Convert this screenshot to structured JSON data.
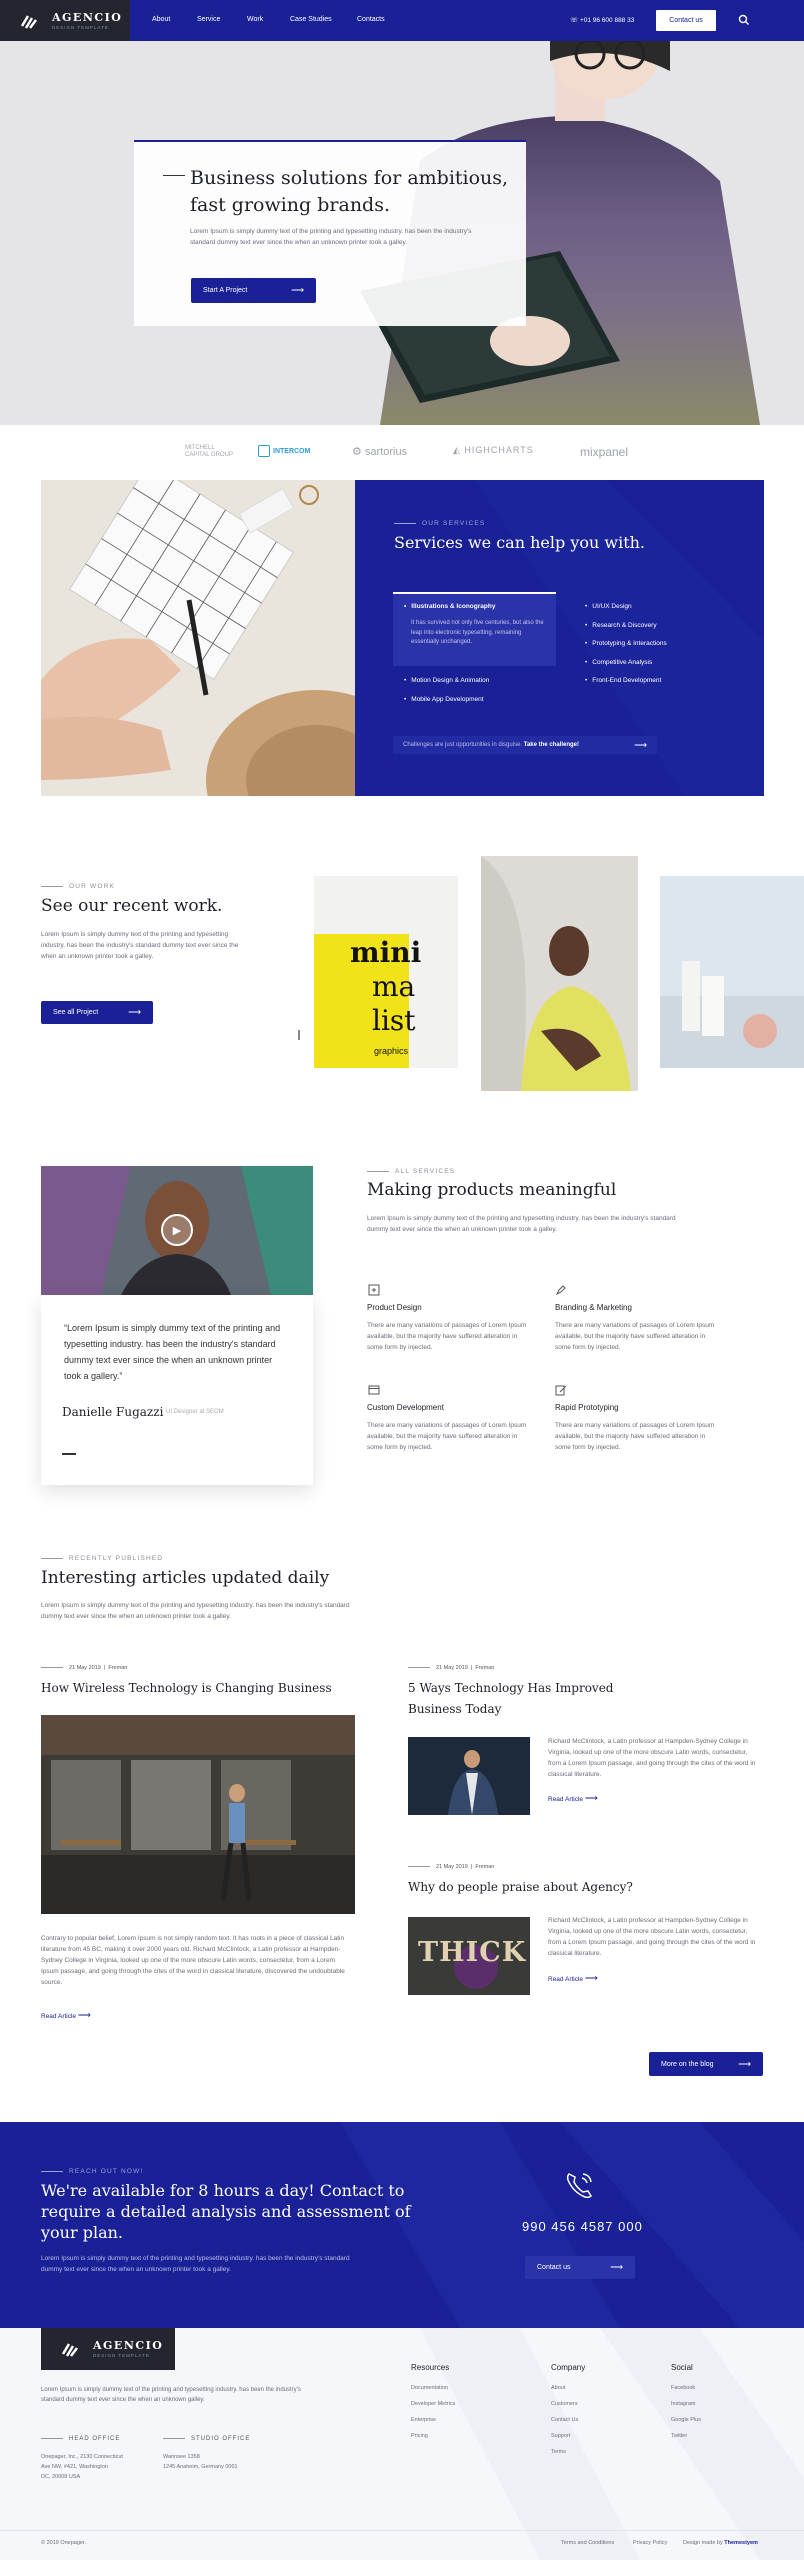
{
  "nav": {
    "brand": "AGENCIO",
    "brand_sub": "DESIGN TEMPLATE",
    "items": [
      "About",
      "Service",
      "Work",
      "Case Studies",
      "Contacts"
    ],
    "phone": "+01 96 600 888 33",
    "contact_label": "Contact us",
    "search_icon": "search-icon"
  },
  "hero": {
    "title": "Business solutions for ambitious, fast growing brands.",
    "text": "Lorem Ipsum is simply dummy text of the printing and typesetting industry. has been the industry's standard dummy text ever since the when an unknown printer took a galley.",
    "button": "Start A Project"
  },
  "logos": [
    "MITCHELL CAPITAL GROUP",
    "INTERCOM",
    "sartorius",
    "HIGHCHARTS",
    "mixpanel"
  ],
  "services": {
    "eyebrow": "OUR SERVICES",
    "title": "Services we can help you with.",
    "active_item": "Illustrations & Iconography",
    "active_desc": "It has survived not only five centuries, but also the leap into electronic typesetting, remaining essentially unchanged.",
    "left_items": [
      "Motion Design & Animation",
      "Mobile App Development"
    ],
    "right_items": [
      "UI/UX Design",
      "Research & Discovery",
      "Prototyping & Interactions",
      "Competitive Analysis",
      "Front-End Development"
    ],
    "bar_text": "Challenges are just opportunities in disguise.",
    "bar_link": "Take the challenge!"
  },
  "work": {
    "eyebrow": "OUR WORK",
    "title": "See our recent work.",
    "text": "Lorem Ipsum is simply dummy text of the printing and typesetting industry. has been the industry's standard dummy text ever since the when an unknown printer took a galley.",
    "button": "See all Project",
    "poster_words": [
      "mini",
      "ma",
      "list"
    ],
    "poster_sub": "graphics"
  },
  "testimonial": {
    "quote": "“Lorem Ipsum is simply dummy text of the printing and typesetting industry. has been the industry's standard dummy text ever since the when an unknown printer took a gallery.”",
    "name": "Danielle Fugazzi",
    "role": "UI Designer at SEOM"
  },
  "products": {
    "eyebrow": "ALL SERVICES",
    "title": "Making products meaningful",
    "text": "Lorem Ipsum is simply dummy text of the printing and typesetting industry. has been the industry's standard dummy text ever since the when an unknown printer took a galley.",
    "items": [
      {
        "name": "Product Design",
        "desc": "There are many variations of passages of Lorem Ipsum available, but the majority have suffered alteration in some form by injected.",
        "icon": "cube-icon"
      },
      {
        "name": "Branding & Marketing",
        "desc": "There are many variations of passages of Lorem Ipsum available, but the majority have suffered alteration in some form by injected.",
        "icon": "pen-icon"
      },
      {
        "name": "Custom Development",
        "desc": "There are many variations of passages of Lorem Ipsum available, but the majority have suffered alteration in some form by injected.",
        "icon": "browser-icon"
      },
      {
        "name": "Rapid Prototyping",
        "desc": "There are many variations of passages of Lorem Ipsum available, but the majority have suffered alteration in some form by injected.",
        "icon": "edit-icon"
      }
    ]
  },
  "articles": {
    "eyebrow": "RECENTLY PUBLISHED",
    "title": "Interesting articles updated daily",
    "text": "Lorem Ipsum is simply dummy text of the printing and typesetting industry. has been the industry's standard dummy text ever since the when an unknown printer took a galley.",
    "main": {
      "date": "21 May 2019",
      "author": "Freman",
      "title": "How Wireless Technology is Changing Business",
      "text": "Contrary to popular belief, Lorem Ipsum is not simply random text. It has roots in a piece of classical Latin literature from 45 BC, making it over 2000 years old. Richard McClintock, a Latin professor at Hampden-Sydney College in Virginia, looked up one of the more obscure Latin words, consectetur, from a Lorem Ipsum passage, and going through the cites of the word in classical literature, discovered the undoubtable source.",
      "read": "Read Article"
    },
    "side": [
      {
        "date": "21 May 2019",
        "author": "Freman",
        "title": "5 Ways Technology Has Improved Business Today",
        "text": "Richard McClintock, a Latin professor at Hampden-Sydney College in Virginia, looked up one of the more obscure Latin words, consectetur, from a Lorem Ipsum passage, and going through the cites of the word in classical literature.",
        "read": "Read Article"
      },
      {
        "date": "21 May 2019",
        "author": "Freman",
        "title": "Why do people praise about Agency?",
        "text": "Richard McClintock, a Latin professor at Hampden-Sydney College in Virginia, looked up one of the more obscure Latin words, consectetur, from a Lorem Ipsum passage, and going through the cites of the word in classical literature.",
        "read": "Read Article",
        "image_word": "THICK"
      }
    ],
    "more_button": "More on the blog"
  },
  "cta": {
    "eyebrow": "REACH OUT NOW!",
    "title": "We're available for 8 hours a day! Contact to require a detailed analysis and assessment of your plan.",
    "text": "Lorem Ipsum is simply dummy text of the printing and typesetting industry. has been the industry's standard dummy text ever since the when an unknown printer took a galley.",
    "phone": "990 456 4587 000",
    "button": "Contact us"
  },
  "footer": {
    "brand": "AGENCIO",
    "brand_sub": "DESIGN TEMPLATE",
    "text": "Lorem Ipsum is simply dummy text of the printing and typesetting industry. has been the industry's standard dummy text ever since the when an unknown galley.",
    "head_office_label": "HEAD OFFICE",
    "head_office": [
      "Onepager, Inc., 2130 Connecticut",
      "Ave NW, #421, Washington",
      "DC, 20008 USA"
    ],
    "studio_label": "STUDIO OFFICE",
    "studio": [
      "Wannsee 1358",
      "1245 Anaheim, Germany 0001"
    ],
    "columns": [
      {
        "title": "Resources",
        "links": [
          "Documentation",
          "Developer Metrics",
          "Enterprise",
          "Pricing"
        ]
      },
      {
        "title": "Company",
        "links": [
          "About",
          "Customers",
          "Contact Us",
          "Support",
          "Terms"
        ]
      },
      {
        "title": "Social",
        "links": [
          "Facebook",
          "Instagram",
          "Google Plus",
          "Twitter"
        ]
      }
    ],
    "copyright": "© 2019 Onepager.",
    "terms": "Terms and Conditions",
    "privacy": "Privacy Policy",
    "design_by": "Design made by",
    "design_by_name": "Themestyem"
  }
}
